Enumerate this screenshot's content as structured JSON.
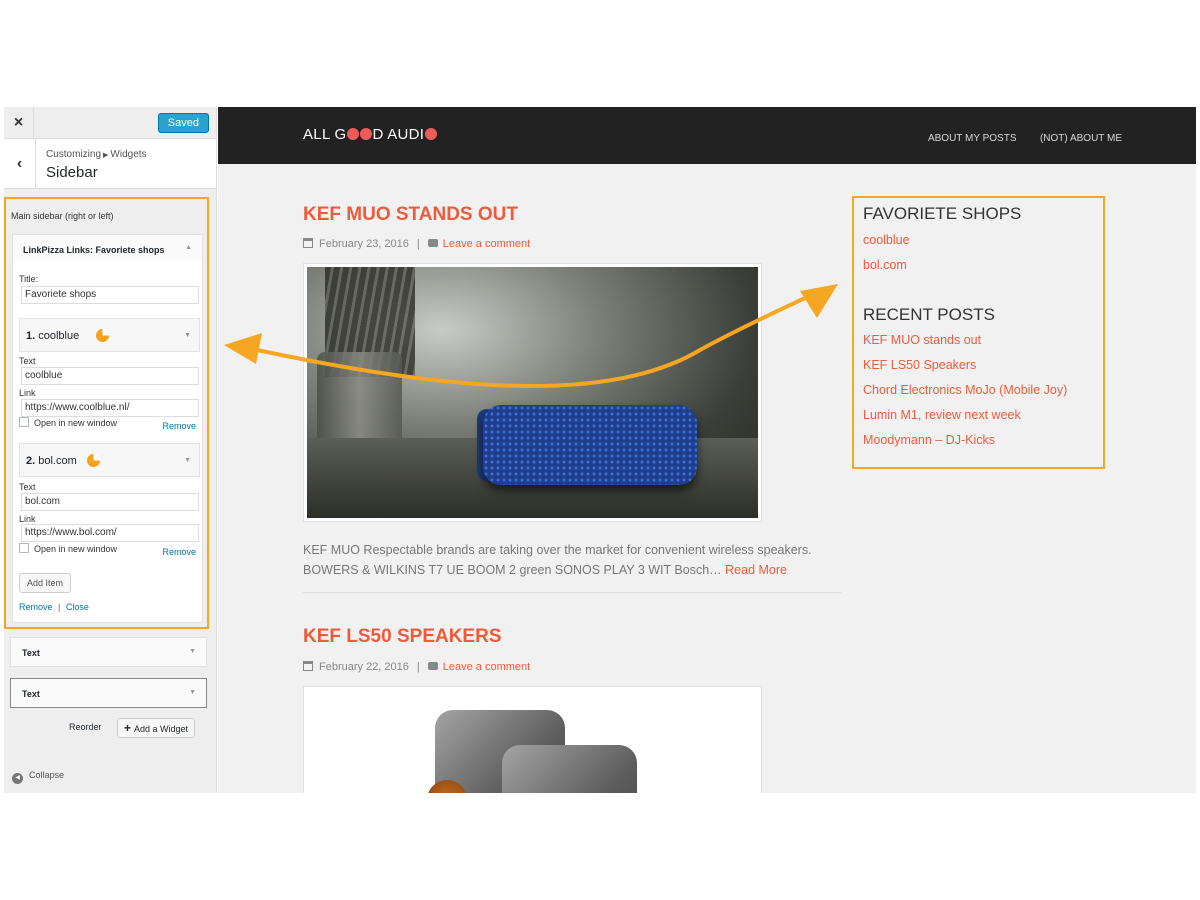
{
  "customizer": {
    "close_icon": "×",
    "saved_label": "Saved",
    "back_icon": "‹",
    "breadcrumb_first": "Customizing",
    "breadcrumb_second": "Widgets",
    "section_title": "Sidebar",
    "area_title": "Main sidebar (right or left)",
    "widget": {
      "label_prefix": "LinkPizza Links:",
      "label_name": "Favoriete shops",
      "title_label": "Title:",
      "title_value": "Favoriete shops",
      "items": [
        {
          "number": "1.",
          "name": "coolblue",
          "text_label": "Text",
          "text_value": "coolblue",
          "link_label": "Link",
          "link_value": "https://www.coolblue.nl/",
          "new_window_label": "Open in new window",
          "remove_label": "Remove"
        },
        {
          "number": "2.",
          "name": "bol.com",
          "text_label": "Text",
          "text_value": "bol.com",
          "link_label": "Link",
          "link_value": "https://www.bol.com/",
          "new_window_label": "Open in new window",
          "remove_label": "Remove"
        }
      ],
      "add_item_label": "Add Item",
      "remove_label": "Remove",
      "separator": "|",
      "close_label": "Close"
    },
    "other_widgets": [
      "Text",
      "Text"
    ],
    "reorder_label": "Reorder",
    "add_widget_label": "Add a Widget",
    "collapse_label": "Collapse"
  },
  "site": {
    "logo_start": "ALL G",
    "logo_end": "D AUDI",
    "nav": [
      "ABOUT MY POSTS",
      "(NOT) ABOUT ME"
    ],
    "posts": [
      {
        "title": "KEF MUO STANDS OUT",
        "date": "February 23, 2016",
        "comment_link": "Leave a comment",
        "excerpt": "KEF MUO Respectable brands are taking over the market for convenient wireless speakers. BOWERS & WILKINS T7 UE BOOM 2 green   SONOS PLAY 3 WIT   Bosch…",
        "read_more": "Read More"
      },
      {
        "title": "KEF LS50 SPEAKERS",
        "date": "February 22, 2016",
        "comment_link": "Leave a comment"
      }
    ],
    "widgets": {
      "shops_title": "FAVORIETE SHOPS",
      "shops": [
        "coolblue",
        "bol.com"
      ],
      "recent_title": "RECENT POSTS",
      "recent": [
        "KEF MUO stands out",
        "KEF LS50 Speakers",
        "Chord Electronics MoJo (Mobile Joy)",
        "Lumin M1, review next week",
        "Moodymann – DJ-Kicks"
      ]
    }
  },
  "colors": {
    "accent_orange": "#f5a623",
    "link_red": "#ee5b3b",
    "wp_blue": "#2ea2cc",
    "header_dark": "#222222"
  },
  "icons": [
    "close-icon",
    "back-chevron-icon",
    "pie-chart-icon",
    "calendar-icon",
    "comment-icon",
    "plus-icon",
    "collapse-arrow-icon",
    "toggle-arrow-icon"
  ]
}
